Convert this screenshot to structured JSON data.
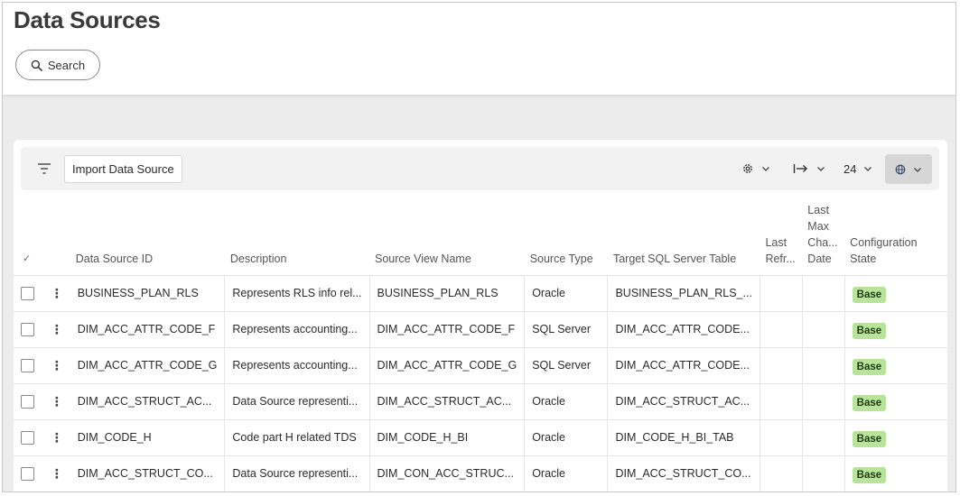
{
  "header": {
    "title": "Data Sources",
    "search_label": "Search"
  },
  "toolbar": {
    "import_label": "Import Data Source",
    "rows_count": "24"
  },
  "table": {
    "select_all_mark": "✓",
    "columns": {
      "id": "Data Source ID",
      "description": "Description",
      "view": "Source View Name",
      "type": "Source Type",
      "target": "Target SQL Server Table",
      "last_refresh": "Last Refr...",
      "last_max_change_1": "Last",
      "last_max_change_2": "Max",
      "last_max_change_3": "Cha...",
      "last_max_change_4": "Date",
      "state": "Configuration State"
    },
    "rows": [
      {
        "id": "BUSINESS_PLAN_RLS",
        "description": "Represents RLS info rel...",
        "view": "BUSINESS_PLAN_RLS",
        "type": "Oracle",
        "target": "BUSINESS_PLAN_RLS_...",
        "last_refresh": "",
        "last_change": "",
        "state": "Base"
      },
      {
        "id": "DIM_ACC_ATTR_CODE_F",
        "description": "Represents accounting...",
        "view": "DIM_ACC_ATTR_CODE_F",
        "type": "SQL Server",
        "target": "DIM_ACC_ATTR_CODE...",
        "last_refresh": "",
        "last_change": "",
        "state": "Base"
      },
      {
        "id": "DIM_ACC_ATTR_CODE_G",
        "description": "Represents accounting...",
        "view": "DIM_ACC_ATTR_CODE_G",
        "type": "SQL Server",
        "target": "DIM_ACC_ATTR_CODE...",
        "last_refresh": "",
        "last_change": "",
        "state": "Base"
      },
      {
        "id": "DIM_ACC_STRUCT_AC...",
        "description": "Data Source representi...",
        "view": "DIM_ACC_STRUCT_AC...",
        "type": "Oracle",
        "target": "DIM_ACC_STRUCT_AC...",
        "last_refresh": "",
        "last_change": "",
        "state": "Base"
      },
      {
        "id": "DIM_CODE_H",
        "description": "Code part H related TDS",
        "view": "DIM_CODE_H_BI",
        "type": "Oracle",
        "target": "DIM_CODE_H_BI_TAB",
        "last_refresh": "",
        "last_change": "",
        "state": "Base"
      },
      {
        "id": "DIM_ACC_STRUCT_CO...",
        "description": "Data Source representi...",
        "view": "DIM_CON_ACC_STRUC...",
        "type": "Oracle",
        "target": "DIM_ACC_STRUCT_CO...",
        "last_refresh": "",
        "last_change": "",
        "state": "Base"
      }
    ]
  },
  "colors": {
    "badge_bg": "#b8e39a",
    "badge_text": "#1d3a10",
    "page_bg": "#ececec"
  },
  "icons": [
    "search-icon",
    "filter-icon",
    "gear-icon",
    "chevron-down-icon",
    "column-width-icon",
    "globe-icon",
    "kebab-icon"
  ]
}
